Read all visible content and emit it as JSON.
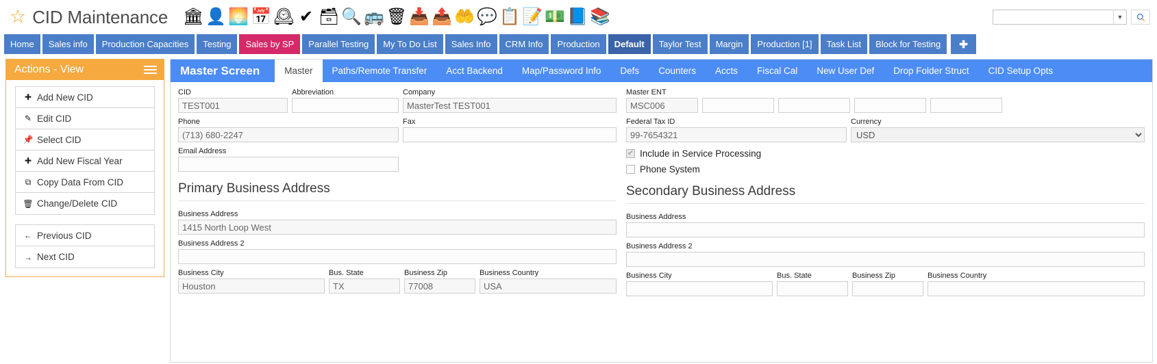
{
  "header": {
    "title": "CID Maintenance",
    "star_icon": "star-icon",
    "search_value": "",
    "search_placeholder": "",
    "toolbar_icons": [
      {
        "name": "bank-icon",
        "glyph": "🏛"
      },
      {
        "name": "person-icon",
        "glyph": "👤"
      },
      {
        "name": "image-icon",
        "glyph": "🌅"
      },
      {
        "name": "calendar-icon",
        "glyph": "📅"
      },
      {
        "name": "clock-icon",
        "glyph": "🕰"
      },
      {
        "name": "checkmark-icon",
        "glyph": "✔"
      },
      {
        "name": "spreadsheet-icon",
        "glyph": "🗃"
      },
      {
        "name": "search-magnifier-icon",
        "glyph": "🔍"
      },
      {
        "name": "truck-icon",
        "glyph": "🚌"
      },
      {
        "name": "trash-icon",
        "glyph": "🗑"
      },
      {
        "name": "download-folder-icon",
        "glyph": "📥"
      },
      {
        "name": "upload-folder-icon",
        "glyph": "📤"
      },
      {
        "name": "money-hand-icon",
        "glyph": "🤲"
      },
      {
        "name": "dollar-chat-icon",
        "glyph": "💬"
      },
      {
        "name": "clipboard-icon",
        "glyph": "📋"
      },
      {
        "name": "pencil-note-icon",
        "glyph": "📝"
      },
      {
        "name": "money-stack-icon",
        "glyph": "💵"
      },
      {
        "name": "globe-book-icon",
        "glyph": "📘"
      },
      {
        "name": "books-icon",
        "glyph": "📚"
      }
    ]
  },
  "tabbar": {
    "tabs": [
      {
        "label": "Home",
        "state": "normal"
      },
      {
        "label": "Sales info",
        "state": "normal"
      },
      {
        "label": "Production Capacities",
        "state": "normal"
      },
      {
        "label": "Testing",
        "state": "normal"
      },
      {
        "label": "Sales by SP",
        "state": "pink"
      },
      {
        "label": "Parallel Testing",
        "state": "normal"
      },
      {
        "label": "My To Do List",
        "state": "normal"
      },
      {
        "label": "Sales Info",
        "state": "normal"
      },
      {
        "label": "CRM Info",
        "state": "normal"
      },
      {
        "label": "Production",
        "state": "normal"
      },
      {
        "label": "Default",
        "state": "active"
      },
      {
        "label": "Taylor Test",
        "state": "normal"
      },
      {
        "label": "Margin",
        "state": "normal"
      },
      {
        "label": "Production [1]",
        "state": "normal"
      },
      {
        "label": "Task List",
        "state": "normal"
      },
      {
        "label": "Block for Testing",
        "state": "normal"
      }
    ],
    "add_tab_label": "✚"
  },
  "sidebar": {
    "title": "Actions - View",
    "menu_icon": "hamburger-icon",
    "group1": [
      {
        "label": "Add New CID",
        "icon": "plus-square-icon",
        "glyph": "✚"
      },
      {
        "label": "Edit CID",
        "icon": "pencil-icon",
        "glyph": "✎"
      },
      {
        "label": "Select CID",
        "icon": "pin-icon",
        "glyph": "📌"
      },
      {
        "label": "Add New Fiscal Year",
        "icon": "plus-square-icon",
        "glyph": "✚"
      },
      {
        "label": "Copy Data From CID",
        "icon": "copy-icon",
        "glyph": "⧉"
      },
      {
        "label": "Change/Delete CID",
        "icon": "trash-icon",
        "glyph": "🗑"
      }
    ],
    "group2": [
      {
        "label": "Previous CID",
        "icon": "arrow-left-icon",
        "glyph": "←"
      },
      {
        "label": "Next CID",
        "icon": "arrow-right-icon",
        "glyph": "→"
      }
    ]
  },
  "panel": {
    "title": "Master Screen",
    "tabs": [
      {
        "label": "Master",
        "state": "active"
      },
      {
        "label": "Paths/Remote Transfer",
        "state": "normal"
      },
      {
        "label": "Acct Backend",
        "state": "normal"
      },
      {
        "label": "Map/Password Info",
        "state": "normal"
      },
      {
        "label": "Defs",
        "state": "normal"
      },
      {
        "label": "Counters",
        "state": "normal"
      },
      {
        "label": "Accts",
        "state": "normal"
      },
      {
        "label": "Fiscal Cal",
        "state": "normal"
      },
      {
        "label": "New User Def",
        "state": "normal"
      },
      {
        "label": "Drop Folder Struct",
        "state": "normal"
      },
      {
        "label": "CID Setup Opts",
        "state": "normal"
      }
    ]
  },
  "form": {
    "cid": {
      "label": "CID",
      "value": "TEST001"
    },
    "abbreviation": {
      "label": "Abbreviation",
      "value": ""
    },
    "company": {
      "label": "Company",
      "value": "MasterTest TEST001"
    },
    "master_ent": {
      "label": "Master ENT",
      "values": [
        "MSC006",
        "",
        "",
        "",
        ""
      ]
    },
    "phone": {
      "label": "Phone",
      "value": "(713) 680-2247"
    },
    "fax": {
      "label": "Fax",
      "value": ""
    },
    "federal_tax_id": {
      "label": "Federal Tax ID",
      "value": "99-7654321"
    },
    "currency": {
      "label": "Currency",
      "value": "USD",
      "options": [
        "USD"
      ]
    },
    "email": {
      "label": "Email Address",
      "value": ""
    },
    "include_service_processing": {
      "label": "Include in Service Processing",
      "checked": true,
      "tick": "✔"
    },
    "phone_system": {
      "label": "Phone System",
      "checked": false,
      "tick": ""
    },
    "primary_section_title": "Primary Business Address",
    "secondary_section_title": "Secondary Business Address",
    "primary": {
      "address1": {
        "label": "Business Address",
        "value": "1415 North Loop West"
      },
      "address2": {
        "label": "Business Address 2",
        "value": ""
      },
      "city": {
        "label": "Business City",
        "value": "Houston"
      },
      "state": {
        "label": "Bus. State",
        "value": "TX"
      },
      "zip": {
        "label": "Business Zip",
        "value": "77008"
      },
      "country": {
        "label": "Business Country",
        "value": "USA"
      }
    },
    "secondary": {
      "address1": {
        "label": "Business Address",
        "value": ""
      },
      "address2": {
        "label": "Business Address 2",
        "value": ""
      },
      "city": {
        "label": "Business City",
        "value": ""
      },
      "state": {
        "label": "Bus. State",
        "value": ""
      },
      "zip": {
        "label": "Business Zip",
        "value": ""
      },
      "country": {
        "label": "Business Country",
        "value": ""
      }
    }
  }
}
